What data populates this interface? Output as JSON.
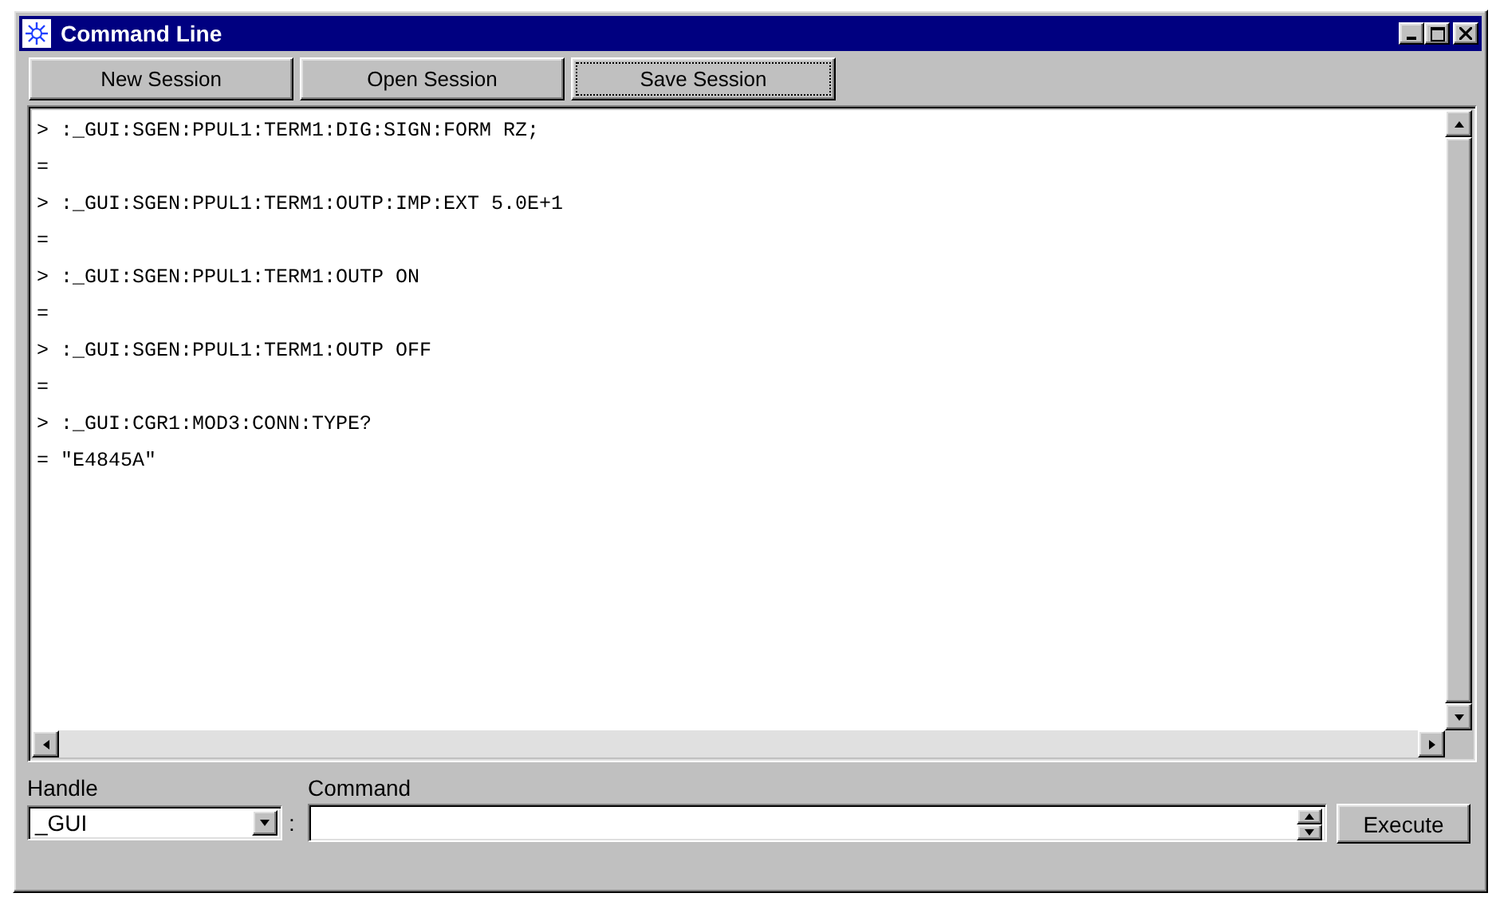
{
  "window": {
    "title": "Command Line"
  },
  "toolbar": [
    {
      "label": "New Session",
      "focused": false
    },
    {
      "label": "Open Session",
      "focused": false
    },
    {
      "label": "Save Session",
      "focused": true
    }
  ],
  "console": {
    "lines": [
      "> :_GUI:SGEN:PPUL1:TERM1:DIG:SIGN:FORM RZ;",
      "=",
      "> :_GUI:SGEN:PPUL1:TERM1:OUTP:IMP:EXT 5.0E+1",
      "=",
      "> :_GUI:SGEN:PPUL1:TERM1:OUTP ON",
      "=",
      "> :_GUI:SGEN:PPUL1:TERM1:OUTP OFF",
      "=",
      "> :_GUI:CGR1:MOD3:CONN:TYPE?",
      "= \"E4845A\""
    ]
  },
  "footer": {
    "handle_label": "Handle",
    "handle_value": "_GUI",
    "separator": ":",
    "command_label": "Command",
    "execute_button": "Execute"
  }
}
